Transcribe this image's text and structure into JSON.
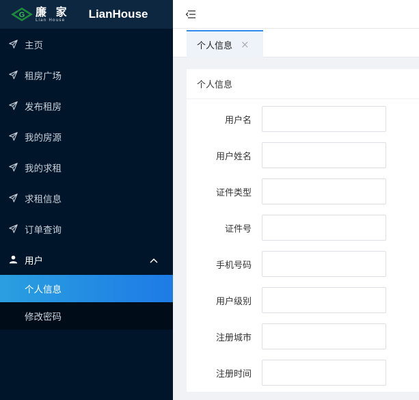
{
  "brand": {
    "cn_name": "廉 家",
    "cn_sub": "Lian   House",
    "en_name": "LianHouse"
  },
  "sidebar": {
    "items": [
      {
        "label": "主页",
        "icon": "paper-plane-icon"
      },
      {
        "label": "租房广场",
        "icon": "paper-plane-icon"
      },
      {
        "label": "发布租房",
        "icon": "paper-plane-icon"
      },
      {
        "label": "我的房源",
        "icon": "paper-plane-icon"
      },
      {
        "label": "我的求租",
        "icon": "paper-plane-icon"
      },
      {
        "label": "求租信息",
        "icon": "paper-plane-icon"
      },
      {
        "label": "订单查询",
        "icon": "paper-plane-icon"
      }
    ],
    "group": {
      "label": "用户",
      "icon": "user-icon",
      "expanded": true,
      "children": [
        {
          "label": "个人信息",
          "active": true
        },
        {
          "label": "修改密码",
          "active": false
        }
      ]
    }
  },
  "tabs": [
    {
      "label": "个人信息",
      "active": true,
      "close": "×"
    }
  ],
  "card": {
    "title": "个人信息"
  },
  "form": {
    "fields": [
      {
        "label": "用户名",
        "value": ""
      },
      {
        "label": "用户姓名",
        "value": ""
      },
      {
        "label": "证件类型",
        "value": ""
      },
      {
        "label": "证件号",
        "value": ""
      },
      {
        "label": "手机号码",
        "value": ""
      },
      {
        "label": "用户级别",
        "value": ""
      },
      {
        "label": "注册城市",
        "value": ""
      },
      {
        "label": "注册时间",
        "value": ""
      }
    ]
  },
  "colors": {
    "sidebar_bg": "#001529",
    "active_item": "#1e7be6",
    "tab_accent": "#2d8cf0"
  }
}
